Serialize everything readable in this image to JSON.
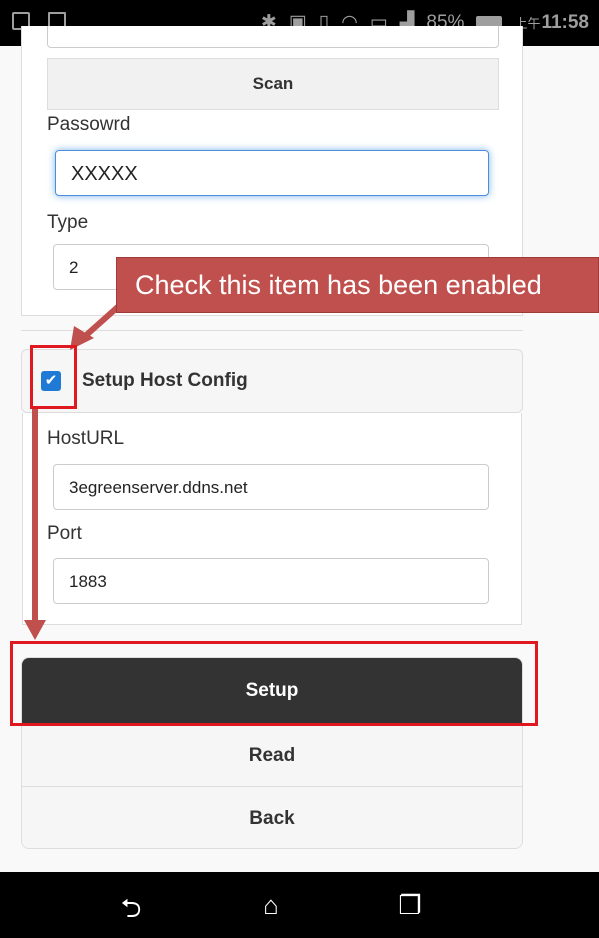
{
  "status_bar": {
    "battery": "85%",
    "time_prefix": "上午",
    "time": "11:58",
    "icons": [
      "screen-icon",
      "mail-icon",
      "bluetooth-icon",
      "nfc-icon",
      "vibrate-icon",
      "wifi-icon",
      "cast-icon",
      "signal-icon",
      "battery-icon"
    ]
  },
  "form": {
    "scan_label": "Scan",
    "password_label": "Passowrd",
    "password_value": "XXXXX",
    "type_label": "Type",
    "type_value": "2",
    "host_config_label": "Setup Host Config",
    "host_config_checked": true,
    "host_url_label": "HostURL",
    "host_url_value": "3egreenserver.ddns.net",
    "port_label": "Port",
    "port_value": "1883"
  },
  "buttons": {
    "setup": "Setup",
    "read": "Read",
    "back": "Back"
  },
  "annotation": {
    "callout_text": "Check this item has been enabled",
    "color": "#c0504d",
    "highlight_color": "#e0181f"
  },
  "nav": {
    "back_icon": "back-icon",
    "home_icon": "home-icon",
    "recents_icon": "recents-icon"
  }
}
